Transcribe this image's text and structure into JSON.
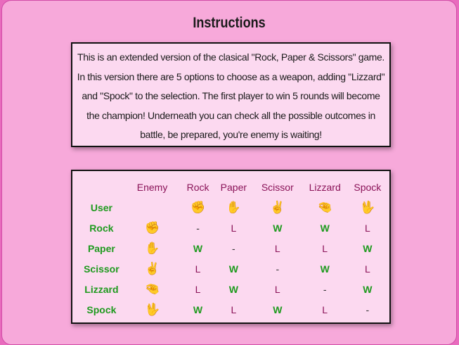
{
  "title": "Instructions",
  "instructions": "This is an extended version of the clasical \"Rock, Paper & Scissors\" game. In this version there are 5 options to choose as a weapon, adding \"Lizzard\" and \"Spock\" to the selection. The first player to win 5 rounds will become the champion! Underneath you can check all the possible outcomes in battle, be prepared, you're enemy is waiting!",
  "table": {
    "enemy_header": "Enemy",
    "user_label": "User",
    "columns": [
      "Rock",
      "Paper",
      "Scissor",
      "Lizzard",
      "Spock"
    ],
    "icons": [
      "✊",
      "✋",
      "✌",
      "🤏",
      "🖖"
    ],
    "rows": [
      {
        "label": "Rock",
        "icon": "✊",
        "results": [
          "-",
          "L",
          "W",
          "W",
          "L"
        ]
      },
      {
        "label": "Paper",
        "icon": "✋",
        "results": [
          "W",
          "-",
          "L",
          "L",
          "W"
        ]
      },
      {
        "label": "Scissor",
        "icon": "✌",
        "results": [
          "L",
          "W",
          "-",
          "W",
          "L"
        ]
      },
      {
        "label": "Lizzard",
        "icon": "🤏",
        "results": [
          "L",
          "W",
          "L",
          "-",
          "W"
        ]
      },
      {
        "label": "Spock",
        "icon": "🖖",
        "results": [
          "W",
          "L",
          "W",
          "L",
          "-"
        ]
      }
    ]
  },
  "colors": {
    "win": "#1e9a1e",
    "lose": "#8a1358",
    "background": "#f7a9da",
    "panel": "#fcd9f0"
  }
}
